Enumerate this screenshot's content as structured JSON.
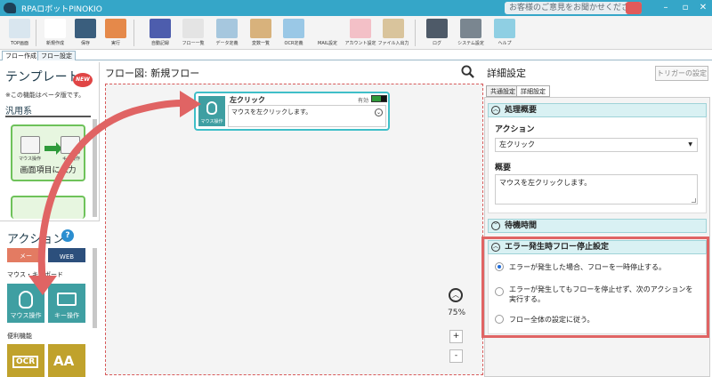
{
  "window": {
    "title": "RPAロボットPINOKIO",
    "feedback": "お客様のご意見をお聞かせください",
    "min": "–",
    "max": "▫",
    "close": "✕"
  },
  "toolbar": {
    "items": [
      {
        "label": "TOP画面",
        "icon": "home-icon",
        "color": "#d9e6ef"
      },
      {
        "label": "新規作成",
        "icon": "new-file-icon",
        "color": "#ffffff"
      },
      {
        "label": "保存",
        "icon": "save-icon",
        "color": "#3a5e7d"
      },
      {
        "label": "実行",
        "icon": "run-icon",
        "color": "#e5894a"
      },
      {
        "label": "自動記録",
        "icon": "recording-icon",
        "color": "#4d5dad"
      },
      {
        "label": "フロー一覧",
        "icon": "flow-list-icon",
        "color": "#e4e4e4"
      },
      {
        "label": "データ定義",
        "icon": "data-definition-icon",
        "color": "#a6c7de"
      },
      {
        "label": "変数一覧",
        "icon": "variables-icon",
        "color": "#d8b27c"
      },
      {
        "label": "OCR定義",
        "icon": "ocr-icon",
        "color": "#9ac8e6"
      },
      {
        "label": "MAIL設定",
        "icon": "mail-icon",
        "color": "#f4f4f4"
      },
      {
        "label": "アカウント設定",
        "icon": "account-icon",
        "color": "#f3c0c7"
      },
      {
        "label": "ファイル入出力",
        "icon": "file-io-icon",
        "color": "#d9c49c"
      },
      {
        "label": "ログ",
        "icon": "log-icon",
        "color": "#4e5a68"
      },
      {
        "label": "システム設定",
        "icon": "gear-icon",
        "color": "#7a8690"
      },
      {
        "label": "ヘルプ",
        "icon": "help-icon",
        "color": "#8fcfe3"
      }
    ]
  },
  "tabs": [
    "フロー作成",
    "フロー設定"
  ],
  "left": {
    "template_title": "テンプレート",
    "new_badge": "NEW",
    "beta_note": "※この機能はベータ版です。",
    "category": "汎用系",
    "template_card_label": "画面項目に入力",
    "mouse_caption": "マウス操作",
    "key_caption": "キー操作",
    "actions_title": "アクション",
    "actions_help": "?",
    "partial_tile_left": "メー",
    "partial_tile_right": "WEB",
    "section_mouse": "マウス・キーボード",
    "tile_mouse": "マウス操作",
    "tile_key": "キー操作",
    "section_util": "便利機能",
    "tile_ocr": "OCR",
    "tile_text": "AA"
  },
  "flow": {
    "title": "フロー図:  新規フロー",
    "node": {
      "title": "左クリック",
      "icon_caption": "マウス操作",
      "enabled_label": "有効",
      "description": "マウスを左クリックします。"
    },
    "zoom": "75%",
    "zoom_in": "+",
    "zoom_out": "-"
  },
  "detail": {
    "title": "詳細設定",
    "trigger_button": "トリガーの設定",
    "tabs": [
      "共通設定",
      "詳細設定"
    ],
    "sections": {
      "overview": "処理概要",
      "wait": "待機時間",
      "error": "エラー発生時フロー停止設定"
    },
    "action_label": "アクション",
    "action_value": "左クリック",
    "summary_label": "概要",
    "summary_value": "マウスを左クリックします。",
    "error_options": [
      "エラーが発生した場合、フローを一時停止する。",
      "エラーが発生してもフローを停止せず、次のアクションを実行する。",
      "フロー全体の設定に従う。"
    ],
    "selected_option": 0
  },
  "colors": {
    "titlebar": "#35a6c8",
    "accent_teal": "#3f9fa2",
    "highlight_red": "#e06464",
    "selected_radio": "#1e6bd8"
  }
}
